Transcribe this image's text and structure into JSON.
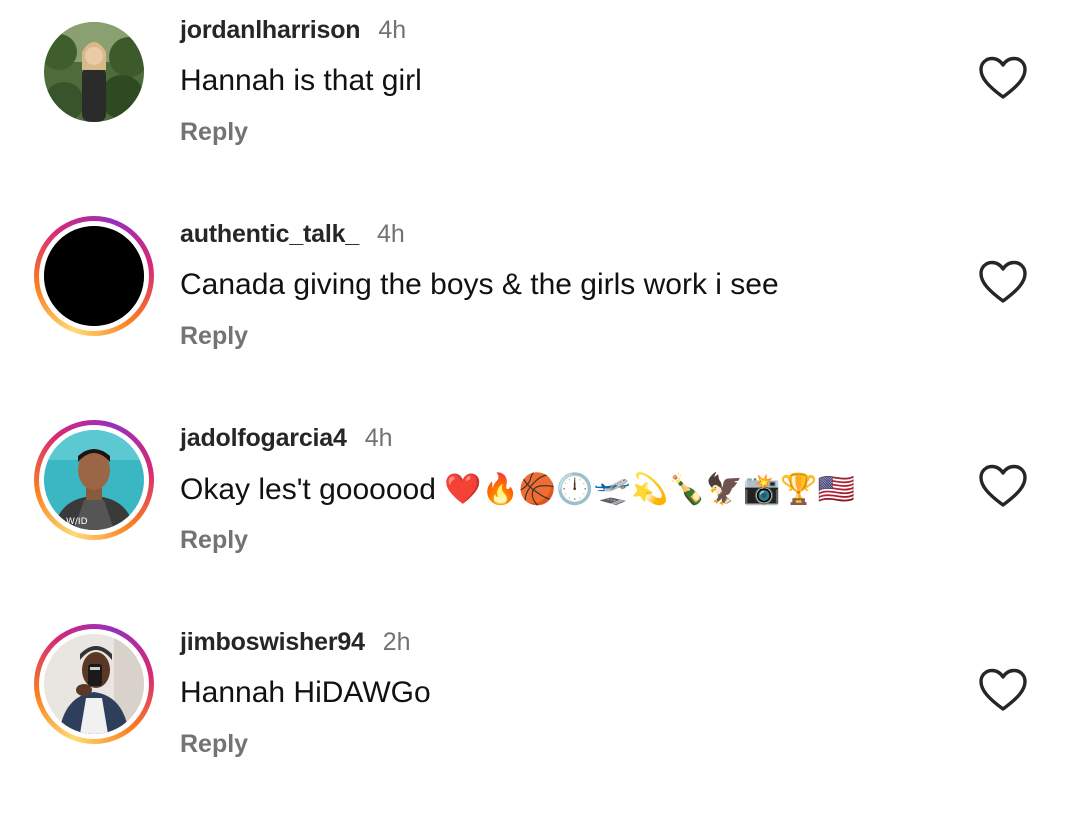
{
  "comments": [
    {
      "username": "jordanlharrison",
      "time": "4h",
      "text": "Hannah is that girl",
      "reply": "Reply",
      "avatar_icon": "photo-woman-plants",
      "has_story_ring": false
    },
    {
      "username": "authentic_talk_",
      "time": "4h",
      "text": "Canada giving the boys & the girls work i see",
      "reply": "Reply",
      "avatar_icon": "black-circle",
      "has_story_ring": true
    },
    {
      "username": "jadolfogarcia4",
      "time": "4h",
      "text": "Okay les't goooood ❤️🔥🏀🕛🛫💫🍾🦅📸🏆🇺🇸",
      "reply": "Reply",
      "avatar_icon": "photo-man-teal-background",
      "has_story_ring": true
    },
    {
      "username": "jimboswisher94",
      "time": "2h",
      "text": "Hannah HiDAWGo",
      "reply": "Reply",
      "avatar_icon": "photo-man-mirror-selfie",
      "has_story_ring": true
    }
  ],
  "colors": {
    "username": "#262626",
    "meta": "#737373",
    "heart_outline": "#262626",
    "ring_gradient": [
      "#feda75",
      "#fa7e1e",
      "#d62976",
      "#962fbf"
    ]
  }
}
